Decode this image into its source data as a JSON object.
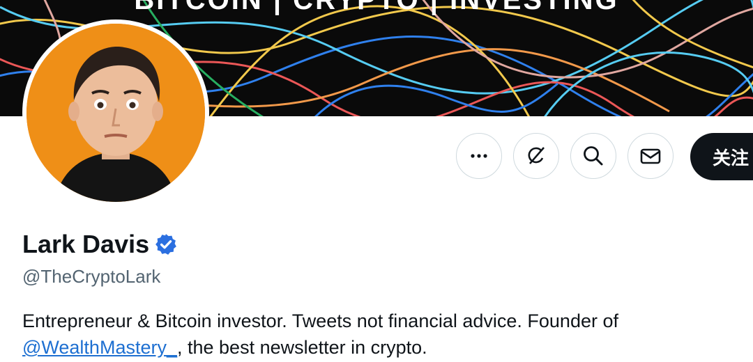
{
  "banner": {
    "title": "BITCOIN | CRYPTO | INVESTING"
  },
  "profile": {
    "name": "Lark Davis",
    "handle": "@TheCryptoLark",
    "verified": true,
    "bio_text": "Entrepreneur & Bitcoin investor. Tweets not financial advice. Founder of",
    "bio_mention": "@WealthMastery_",
    "bio_suffix": ", the best newsletter in crypto."
  },
  "actions": {
    "more_icon": "more-horizontal-icon",
    "grok_icon": "grok-icon",
    "search_icon": "search-icon",
    "message_icon": "envelope-icon",
    "follow_label": "关注"
  },
  "colors": {
    "accent": "#1d9bf0",
    "avatar_bg": "#ef8f17",
    "follow_bg": "#0f1419",
    "banner_bg": "#0a0a0a"
  }
}
